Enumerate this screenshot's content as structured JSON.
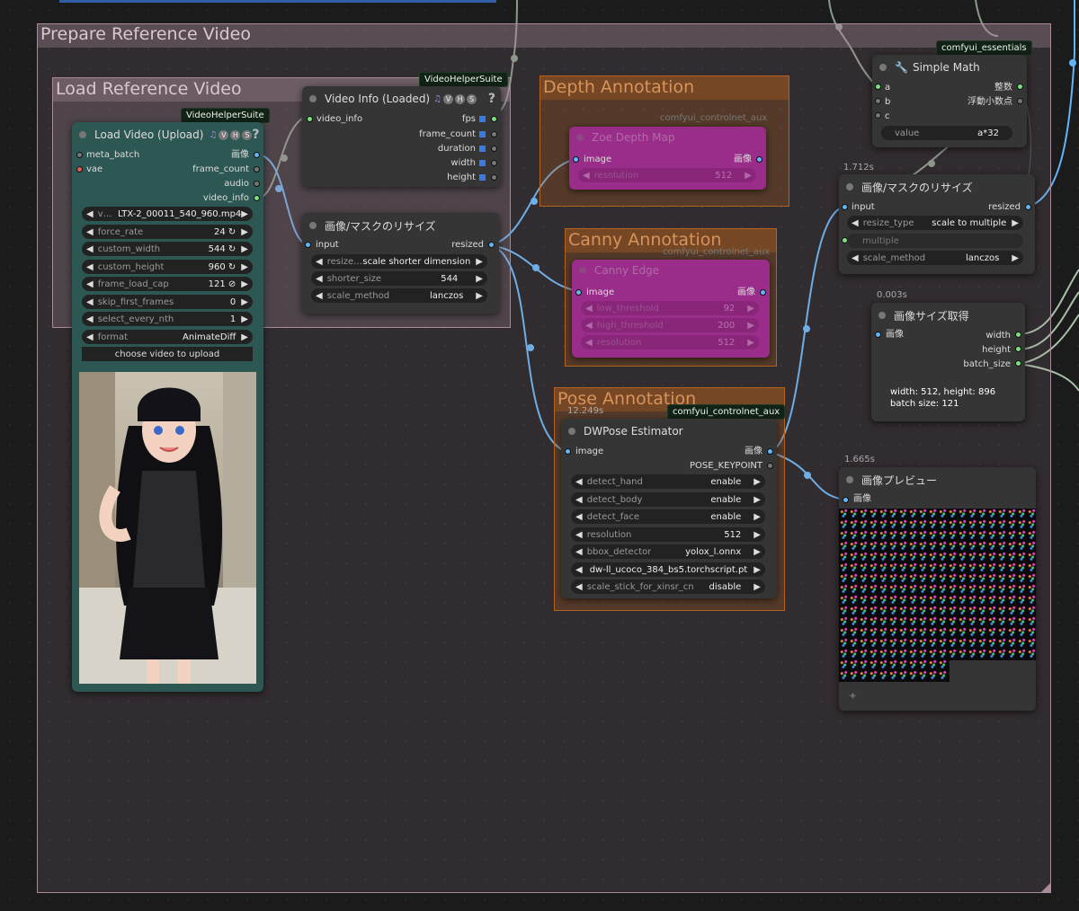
{
  "groups": {
    "prepare": "Prepare Reference Video",
    "load_ref": "Load Reference Video",
    "depth": "Depth Annotation",
    "canny": "Canny Annotation",
    "pose": "Pose Annotation"
  },
  "nodes": {
    "load_video": {
      "badge": "VideoHelperSuite",
      "title": "Load Video (Upload)",
      "help": "?",
      "inputs": [
        "meta_batch",
        "vae"
      ],
      "outputs": [
        "画像",
        "frame_count",
        "audio",
        "video_info"
      ],
      "widgets": [
        {
          "label": "vi...",
          "value": "LTX-2_00011_540_960.mp4"
        },
        {
          "label": "force_rate",
          "value": "24 ↻"
        },
        {
          "label": "custom_width",
          "value": "544 ↻"
        },
        {
          "label": "custom_height",
          "value": "960 ↻"
        },
        {
          "label": "frame_load_cap",
          "value": "121 ⊘"
        },
        {
          "label": "skip_first_frames",
          "value": "0"
        },
        {
          "label": "select_every_nth",
          "value": "1"
        },
        {
          "label": "format",
          "value": "AnimateDiff"
        }
      ],
      "upload_button": "choose video to upload"
    },
    "video_info": {
      "badge": "VideoHelperSuite",
      "title": "Video Info (Loaded)",
      "help": "?",
      "input": "video_info",
      "outputs": [
        "fps",
        "frame_count",
        "duration",
        "width",
        "height"
      ]
    },
    "resize1": {
      "title": "画像/マスクのリサイズ",
      "input": "input",
      "output": "resized",
      "widgets": [
        {
          "label": "resize ...",
          "value": "scale shorter dimension"
        },
        {
          "label": "shorter_size",
          "value": "544"
        },
        {
          "label": "scale_method",
          "value": "lanczos"
        }
      ]
    },
    "zoe": {
      "badge": "comfyui_controlnet_aux",
      "title": "Zoe Depth Map",
      "input": "image",
      "output": "画像",
      "widgets": [
        {
          "label": "resolution",
          "value": "512"
        }
      ]
    },
    "canny": {
      "badge": "comfyui_controlnet_aux",
      "title": "Canny Edge",
      "input": "image",
      "output": "画像",
      "widgets": [
        {
          "label": "low_threshold",
          "value": "92"
        },
        {
          "label": "high_threshold",
          "value": "200"
        },
        {
          "label": "resolution",
          "value": "512"
        }
      ]
    },
    "dwpose": {
      "badge": "comfyui_controlnet_aux",
      "time": "12.249s",
      "title": "DWPose Estimator",
      "input": "image",
      "outputs": [
        "画像",
        "POSE_KEYPOINT"
      ],
      "widgets": [
        {
          "label": "detect_hand",
          "value": "enable"
        },
        {
          "label": "detect_body",
          "value": "enable"
        },
        {
          "label": "detect_face",
          "value": "enable"
        },
        {
          "label": "resolution",
          "value": "512"
        },
        {
          "label": "bbox_detector",
          "value": "yolox_l.onnx"
        },
        {
          "label": "",
          "value": "dw-ll_ucoco_384_bs5.torchscript.pt"
        },
        {
          "label": "scale_stick_for_xinsr_cn",
          "value": "disable"
        }
      ]
    },
    "simple_math": {
      "badge": "comfyui_essentials",
      "title": "Simple Math",
      "inputs": [
        "a",
        "b",
        "c"
      ],
      "outputs": [
        "整数",
        "浮動小数点"
      ],
      "widget": {
        "label": "value",
        "value": "a*32"
      }
    },
    "resize2": {
      "time": "1.712s",
      "title": "画像/マスクのリサイズ",
      "input": "input",
      "output": "resized",
      "widgets": [
        {
          "label": "resize_type",
          "value": "scale to multiple"
        },
        {
          "label": "multiple",
          "value": ""
        },
        {
          "label": "scale_method",
          "value": "lanczos"
        }
      ]
    },
    "get_size": {
      "time": "0.003s",
      "title": "画像サイズ取得",
      "input": "画像",
      "outputs": [
        "width",
        "height",
        "batch_size"
      ],
      "info_line1": "width: 512, height: 896",
      "info_line2": "batch size: 121"
    },
    "preview": {
      "time": "1.665s",
      "title": "画像プレビュー",
      "input": "画像"
    }
  },
  "colors": {
    "wire_image": "#64b5f6",
    "wire_green": "#8a9a8a",
    "pin_green": "#7ee07e",
    "pin_blue": "#64b5f6",
    "pin_red": "#e06060",
    "group_prepare": "#a88a9a",
    "group_orange": "#b4621e",
    "group_magenta": "#8a2a7a",
    "node_teal": "#2d5753"
  }
}
